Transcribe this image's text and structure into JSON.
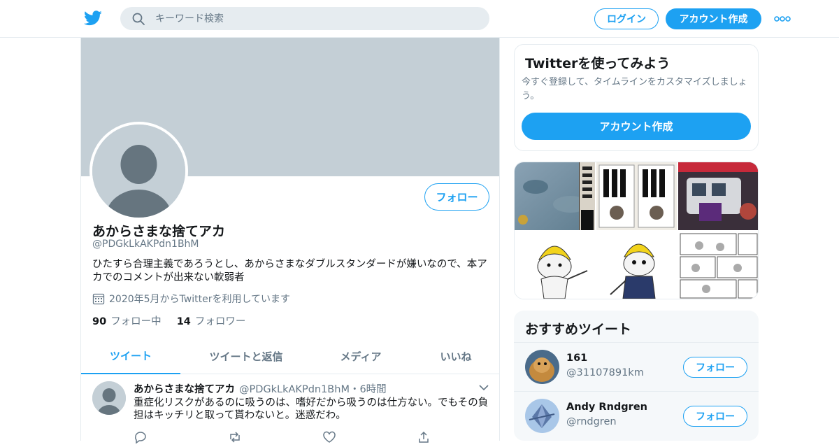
{
  "colors": {
    "accent": "#1da1f2",
    "muted": "#657786",
    "banner": "#c4cfd6",
    "border": "#e6ecf0"
  },
  "topbar": {
    "logo_icon": "twitter-bird-icon",
    "search_placeholder": "キーワード検索",
    "login_label": "ログイン",
    "signup_label": "アカウント作成",
    "more_icon": "more-dots-icon"
  },
  "profile": {
    "name": "あからさまな捨てアカ",
    "handle": "@PDGkLkAKPdn1BhM",
    "bio": "ひたすら合理主義であろうとし、あからさまなダブルスタンダードが嫌いなので、本アカでのコメントが出来ない軟弱者",
    "joined": "2020年5月からTwitterを利用しています",
    "follow_label": "フォロー",
    "following_count": "90",
    "following_label": "フォロー中",
    "followers_count": "14",
    "followers_label": "フォロワー"
  },
  "tabs": [
    {
      "label": "ツイート",
      "active": true
    },
    {
      "label": "ツイートと返信",
      "active": false
    },
    {
      "label": "メディア",
      "active": false
    },
    {
      "label": "いいね",
      "active": false
    }
  ],
  "tweet": {
    "name": "あからさまな捨てアカ",
    "handle_time": "@PDGkLkAKPdn1BhM・6時間",
    "text": "重症化リスクがあるのに吸うのは、嗜好だから吸うのは仕方ない。でもその負担はキッチリと取って貰わないと。迷惑だわ。"
  },
  "signup_card": {
    "title": "Twitterを使ってみよう",
    "desc": "今すぐ登録して、タイムラインをカスタマイズしましょう。",
    "button": "アカウント作成"
  },
  "media": {
    "items": [
      "underwater-photo",
      "newspaper-clipping",
      "newspaper-clipping",
      "train-news-screenshot",
      "cat-mascot-image",
      "cat-mascot-image",
      "manga-page"
    ]
  },
  "recommended": {
    "title": "おすすめツイート",
    "users": [
      {
        "name": "161",
        "handle": "@31107891km",
        "follow": "フォロー"
      },
      {
        "name": "Andy Rndgren",
        "handle": "@rndgren",
        "follow": "フォロー"
      }
    ]
  }
}
